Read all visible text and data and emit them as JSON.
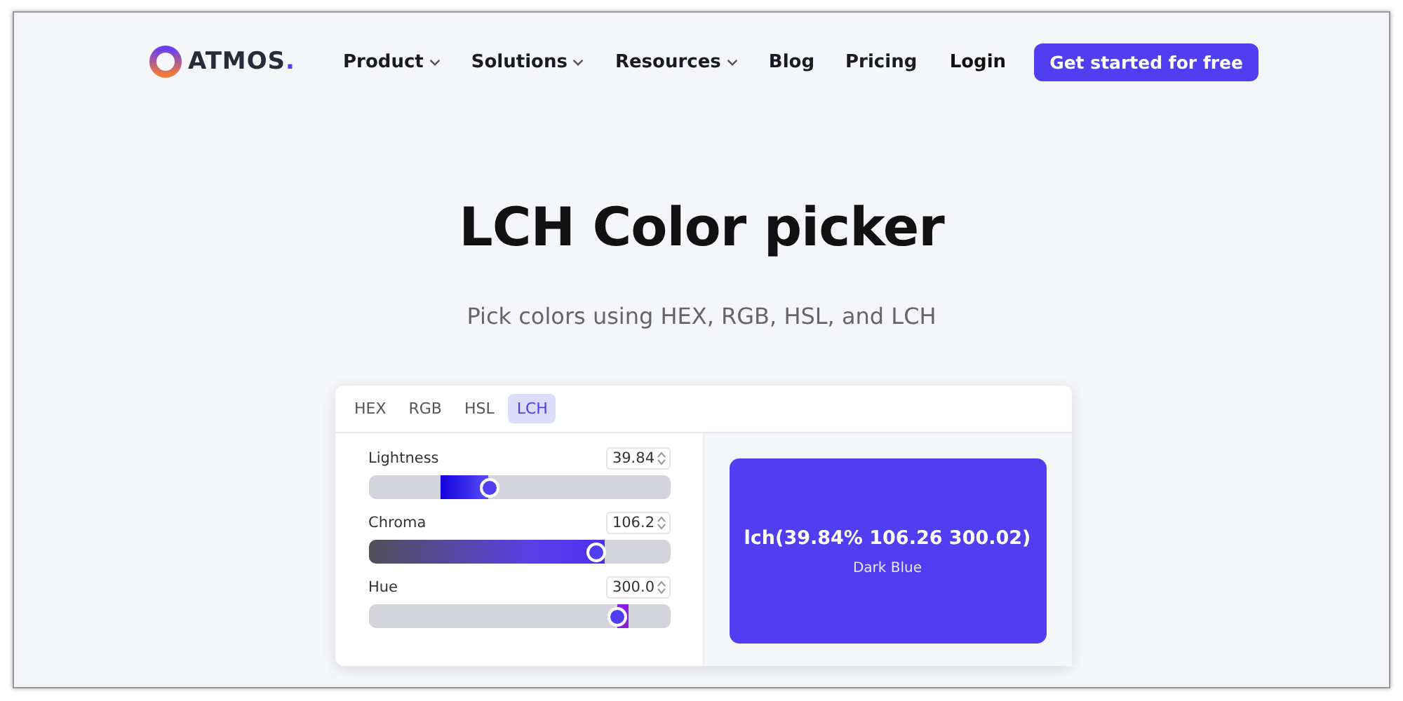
{
  "nav": {
    "logo": "ATMOS",
    "logo_dot": ".",
    "links": [
      {
        "label": "Product",
        "dropdown": true
      },
      {
        "label": "Solutions",
        "dropdown": true
      },
      {
        "label": "Resources",
        "dropdown": true
      },
      {
        "label": "Blog",
        "dropdown": false
      },
      {
        "label": "Pricing",
        "dropdown": false
      }
    ],
    "login": "Login",
    "cta": "Get started for free"
  },
  "hero": {
    "title": "LCH Color picker",
    "subtitle": "Pick colors using HEX, RGB, HSL, and LCH"
  },
  "picker": {
    "tabs": [
      {
        "label": "HEX",
        "selected": false
      },
      {
        "label": "RGB",
        "selected": false
      },
      {
        "label": "HSL",
        "selected": false
      },
      {
        "label": "LCH",
        "selected": true
      }
    ],
    "sliders": [
      {
        "kind": "lightness",
        "label": "Lightness",
        "value": "39.84",
        "level": 0.4
      },
      {
        "kind": "chroma",
        "label": "Chroma",
        "value": "106.2",
        "level": 0.755
      },
      {
        "kind": "hue",
        "label": "Hue",
        "value": "300.0",
        "level": 0.825
      }
    ],
    "preview": {
      "value": "lch(39.84% 106.26 300.02)",
      "name": "Dark Blue"
    }
  }
}
